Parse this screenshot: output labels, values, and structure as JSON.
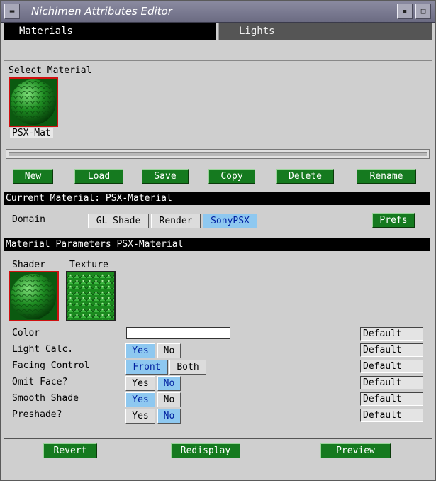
{
  "window": {
    "title": "Nichimen Attributes Editor"
  },
  "tabs": {
    "materials": "Materials",
    "lights": "Lights"
  },
  "select_material": {
    "heading": "Select Material",
    "items": [
      {
        "label": "PSX-Mat"
      }
    ]
  },
  "material_buttons": {
    "new": "New",
    "load": "Load",
    "save": "Save",
    "copy": "Copy",
    "delete": "Delete",
    "rename": "Rename"
  },
  "current_material": {
    "title": "Current Material: PSX-Material"
  },
  "domain": {
    "label": "Domain",
    "options": [
      "GL Shade",
      "Render",
      "SonyPSX"
    ],
    "selected": "SonyPSX",
    "prefs": "Prefs"
  },
  "material_parameters": {
    "title": "Material Parameters PSX-Material",
    "shader_label": "Shader",
    "texture_label": "Texture"
  },
  "params": {
    "color": {
      "label": "Color",
      "value": "",
      "default": "Default"
    },
    "light_calc": {
      "label": "Light Calc.",
      "options": [
        "Yes",
        "No"
      ],
      "selected": "Yes",
      "default": "Default"
    },
    "facing_control": {
      "label": "Facing Control",
      "options": [
        "Front",
        "Both"
      ],
      "selected": "Front",
      "default": "Default"
    },
    "omit_face": {
      "label": "Omit Face?",
      "options": [
        "Yes",
        "No"
      ],
      "selected": "No",
      "default": "Default"
    },
    "smooth_shade": {
      "label": "Smooth Shade",
      "options": [
        "Yes",
        "No"
      ],
      "selected": "Yes",
      "default": "Default"
    },
    "preshade": {
      "label": "Preshade?",
      "options": [
        "Yes",
        "No"
      ],
      "selected": "No",
      "default": "Default"
    }
  },
  "footer": {
    "revert": "Revert",
    "redisplay": "Redisplay",
    "preview": "Preview"
  },
  "colors": {
    "accent_green": "#157a1f",
    "selected_blue": "#8ec8f0",
    "swatch_border": "#d01010"
  }
}
